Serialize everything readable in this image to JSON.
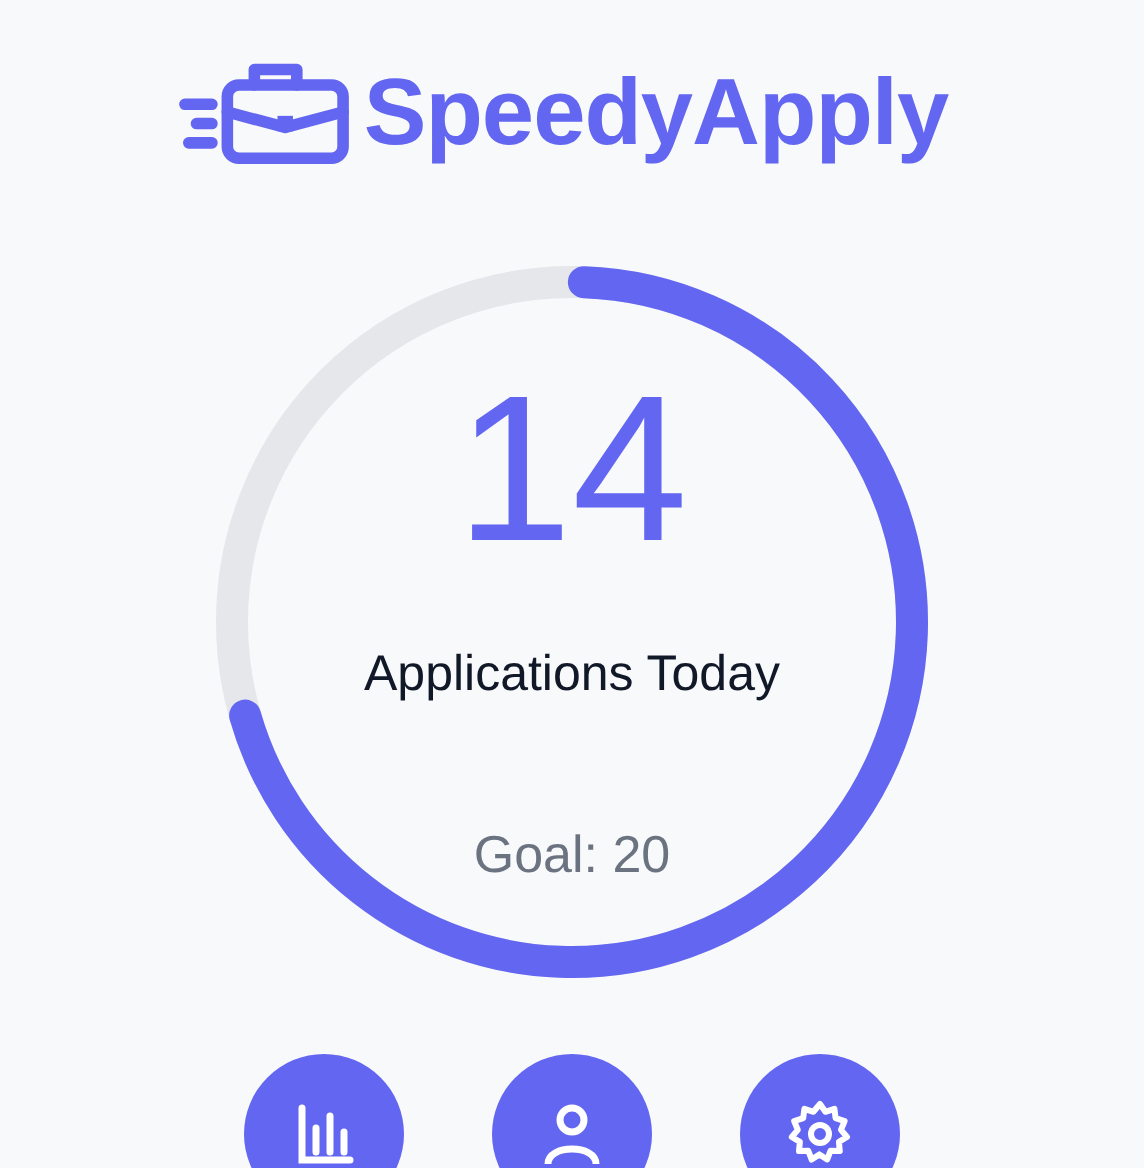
{
  "brand": "SpeedyApply",
  "progress": {
    "count": "14",
    "label": "Applications Today",
    "goal": "Goal: 20"
  },
  "nav_buttons": [
    {
      "kind": "stats"
    },
    {
      "kind": "profile"
    },
    {
      "kind": "settings"
    }
  ]
}
